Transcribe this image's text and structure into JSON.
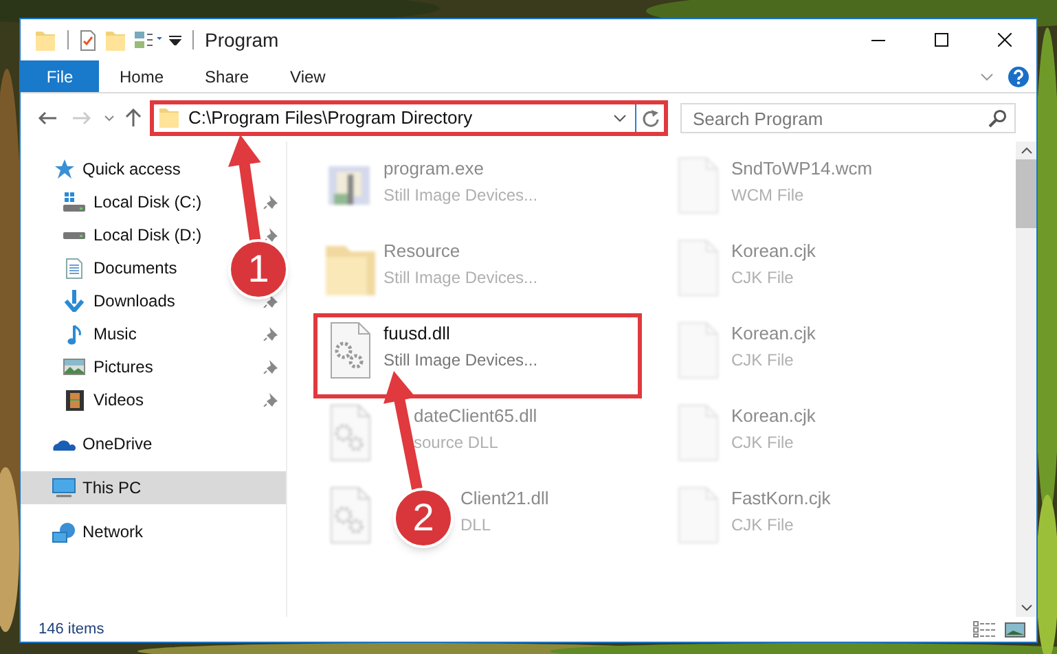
{
  "window": {
    "title": "Program"
  },
  "ribbon": {
    "tabs": [
      {
        "label": "File",
        "kind": "file"
      },
      {
        "label": "Home",
        "kind": "tab"
      },
      {
        "label": "Share",
        "kind": "tab"
      },
      {
        "label": "View",
        "kind": "tab"
      }
    ]
  },
  "address_bar": {
    "path": "C:\\Program Files\\Program Directory",
    "highlighted": true
  },
  "search": {
    "placeholder": "Search Program"
  },
  "sidebar": {
    "items": [
      {
        "label": "Quick access",
        "kind": "star",
        "selected": false,
        "children": [
          {
            "label": "Local Disk (C:)",
            "kind": "system-disk",
            "pinned": true
          },
          {
            "label": "Local Disk (D:)",
            "kind": "disk",
            "pinned": true
          },
          {
            "label": "Documents",
            "kind": "documents"
          },
          {
            "label": "Downloads",
            "kind": "downloads",
            "pinned": true
          },
          {
            "label": "Music",
            "kind": "music",
            "pinned": true
          },
          {
            "label": "Pictures",
            "kind": "pictures",
            "pinned": true
          },
          {
            "label": "Videos",
            "kind": "videos",
            "pinned": true
          }
        ]
      },
      {
        "label": "OneDrive",
        "kind": "cloud",
        "selected": false
      },
      {
        "label": "This PC",
        "kind": "pc",
        "selected": true
      },
      {
        "label": "Network",
        "kind": "network",
        "selected": false
      }
    ]
  },
  "files": [
    {
      "name": "program.exe",
      "type": "Still Image Devices...",
      "kind": "exe",
      "dimmed": true,
      "highlighted": false
    },
    {
      "name": "SndToWP14.wcm",
      "type": "WCM File",
      "kind": "blank",
      "dimmed": true,
      "highlighted": false
    },
    {
      "name": "Resource",
      "type": "Still Image Devices...",
      "kind": "folder",
      "dimmed": true,
      "highlighted": false
    },
    {
      "name": "Korean.cjk",
      "type": "CJK File",
      "kind": "blank",
      "dimmed": true,
      "highlighted": false
    },
    {
      "name": "fuusd.dll",
      "type": "Still Image Devices...",
      "kind": "dll",
      "dimmed": false,
      "highlighted": true
    },
    {
      "name": "Korean.cjk",
      "type": "CJK File",
      "kind": "blank",
      "dimmed": true,
      "highlighted": false
    },
    {
      "name": "dateClient65.dll",
      "type": "source DLL",
      "kind": "dll",
      "dimmed": true,
      "highlighted": false
    },
    {
      "name": "Korean.cjk",
      "type": "CJK File",
      "kind": "blank",
      "dimmed": true,
      "highlighted": false
    },
    {
      "name": "Client21.dll",
      "type": "DLL",
      "kind": "dll",
      "dimmed": true,
      "highlighted": false
    },
    {
      "name": "FastKorn.cjk",
      "type": "CJK File",
      "kind": "blank",
      "dimmed": true,
      "highlighted": false
    }
  ],
  "status_bar": {
    "count": "146 items"
  },
  "annotations": [
    {
      "label": "1"
    },
    {
      "label": "2"
    }
  ]
}
